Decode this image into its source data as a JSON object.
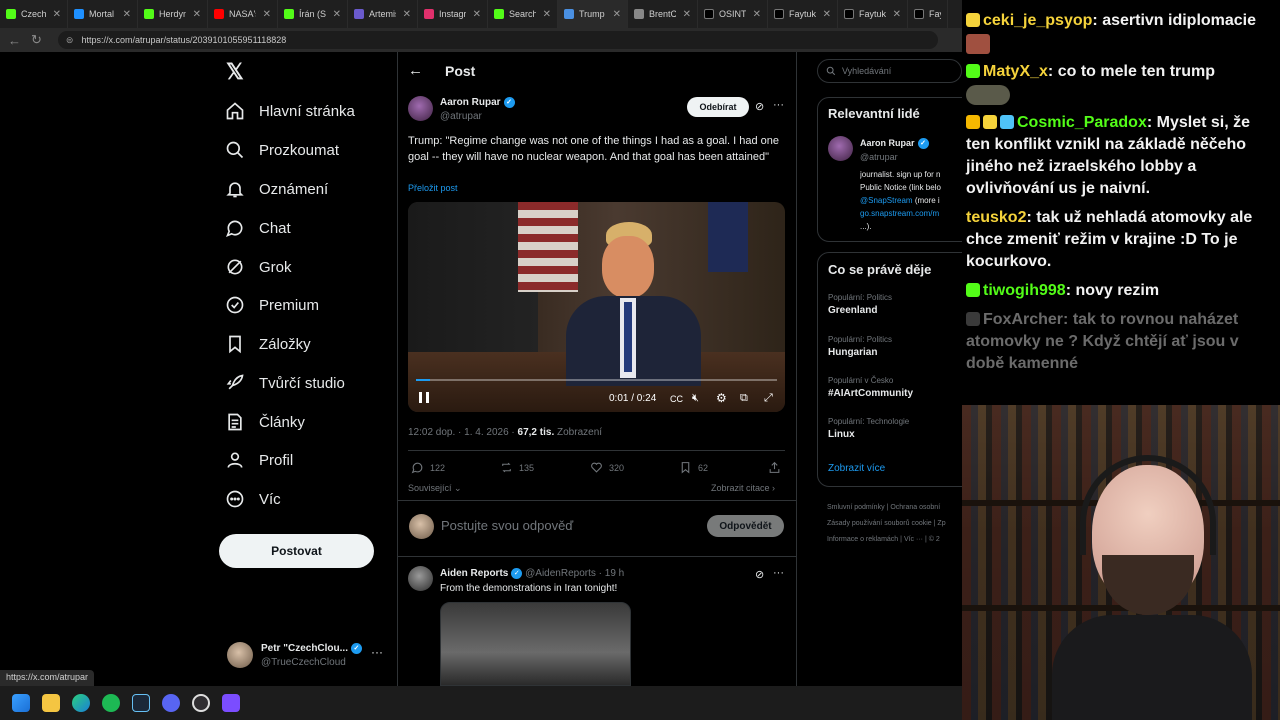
{
  "browser": {
    "tabs": [
      {
        "label": "CzechClo",
        "color": "#53fc18"
      },
      {
        "label": "Mortal S",
        "color": "#1e90ff"
      },
      {
        "label": "HerdynO",
        "color": "#53fc18"
      },
      {
        "label": "NASA's A",
        "color": "#ff0000"
      },
      {
        "label": "Írán (Stát",
        "color": "#53fc18"
      },
      {
        "label": "Artemis I",
        "color": "#6a5acd"
      },
      {
        "label": "Instagran",
        "color": "#e1306c"
      },
      {
        "label": "Search -",
        "color": "#53fc18"
      },
      {
        "label": "Trump si",
        "color": "#4a90e2"
      },
      {
        "label": "BrentCha",
        "color": "#888888"
      },
      {
        "label": "OSINTde",
        "color": "#000000"
      },
      {
        "label": "Faytuks N",
        "color": "#000000"
      },
      {
        "label": "Faytuks N",
        "color": "#000000"
      },
      {
        "label": "Fayt",
        "color": "#000000"
      }
    ],
    "url": "https://x.com/atrupar/status/2039101055951118828",
    "status_url": "https://x.com/atrupar"
  },
  "sidebar": {
    "items": [
      {
        "label": "Hlavní stránka",
        "icon": "home-icon"
      },
      {
        "label": "Prozkoumat",
        "icon": "search-icon"
      },
      {
        "label": "Oznámení",
        "icon": "bell-icon"
      },
      {
        "label": "Chat",
        "icon": "chat-icon"
      },
      {
        "label": "Grok",
        "icon": "grok-icon"
      },
      {
        "label": "Premium",
        "icon": "premium-icon"
      },
      {
        "label": "Záložky",
        "icon": "bookmark-icon"
      },
      {
        "label": "Tvůrčí studio",
        "icon": "rocket-icon"
      },
      {
        "label": "Články",
        "icon": "articles-icon"
      },
      {
        "label": "Profil",
        "icon": "profile-icon"
      },
      {
        "label": "Víc",
        "icon": "more-icon"
      }
    ],
    "post_button": "Postovat",
    "account": {
      "name": "Petr \"CzechClou...",
      "handle": "@TrueCzechCloud"
    }
  },
  "main": {
    "header_title": "Post",
    "post": {
      "author": "Aaron Rupar",
      "handle": "@atrupar",
      "follow_label": "Odebírat",
      "text": "Trump: \"Regime change was not one of the things I had as a goal. I had one goal -- they will have no nuclear weapon. And that goal has been attained\"",
      "translate": "Přeložit post",
      "video_time": "0:01 / 0:24",
      "video_progress": 0.04,
      "timestamp": "12:02 dop. · 1. 4. 2026 · ",
      "views_count": "67,2 tis.",
      "views_label": " Zobrazení",
      "replies": "122",
      "reposts": "135",
      "likes": "320",
      "bookmarks": "62",
      "related_label": "Související",
      "quotes_label": "Zobrazit citace"
    },
    "reply_placeholder": "Postujte svou odpověď",
    "reply_button": "Odpovědět",
    "reply": {
      "author": "Aiden Reports",
      "handle": "@AidenReports",
      "time": "· 19 h",
      "text": "From the demonstrations in Iran tonight!"
    }
  },
  "right": {
    "search_placeholder": "Vyhledávání",
    "relevant_title": "Relevantní lidé",
    "relevant_person": {
      "name": "Aaron Rupar",
      "handle": "@atrupar",
      "bio_1": "journalist. sign up for n",
      "bio_2": "Public Notice (link belo",
      "bio_3_link": "@SnapStream",
      "bio_3_rest": " (more i",
      "bio_4_link": "go.snapstream.com/m",
      "bio_5": "...)."
    },
    "trends_title": "Co se právě děje",
    "trends": [
      {
        "category": "Populární: Politics",
        "name": "Greenland"
      },
      {
        "category": "Populární: Politics",
        "name": "Hungarian"
      },
      {
        "category": "Populární v Česko",
        "name": "#AIArtCommunity"
      },
      {
        "category": "Populární: Technologie",
        "name": "Linux"
      }
    ],
    "show_more": "Zobrazit více",
    "footer": [
      "Smluvní podmínky",
      "|",
      "Ochrana osobní",
      "Zásady používání souborů cookie",
      "|",
      "Zp",
      "Informace o reklamách",
      "|",
      "Víc ···",
      "|",
      "© 2"
    ]
  },
  "chat": {
    "messages": [
      {
        "user": "ceki_je_psyop",
        "sep": ": ",
        "text": "asertivn idiplomacie",
        "color": "#f5d33b"
      },
      {
        "user": "MatyX_x",
        "sep": ": ",
        "text": "co to mele ten trump",
        "color": "#f5d33b"
      },
      {
        "user": "Cosmic_Paradox",
        "sep": ": ",
        "text": "Myslet si, že ten konflikt vznikl na základě něčeho jiného než izraelského lobby a ovlivňování us je naivní.",
        "color": "#53fc18"
      },
      {
        "user": "teusko2",
        "sep": ": ",
        "text": "tak už nehladá atomovky ale chce zmeniť režim v krajine :D To je kocurkovo.",
        "color": "#f5d33b"
      },
      {
        "user": "tiwogih998",
        "sep": ": ",
        "text": "novy rezim",
        "color": "#53fc18"
      },
      {
        "user": "FoxArcher",
        "sep": ": ",
        "text": "tak to rovnou naházet atomovky ne ? Když chtějí ať jsou v době kamenné",
        "color": "#6b6b6b"
      }
    ]
  },
  "colors": {
    "accent": "#1d9bf0",
    "bg": "#000000",
    "border": "#2f3336"
  }
}
